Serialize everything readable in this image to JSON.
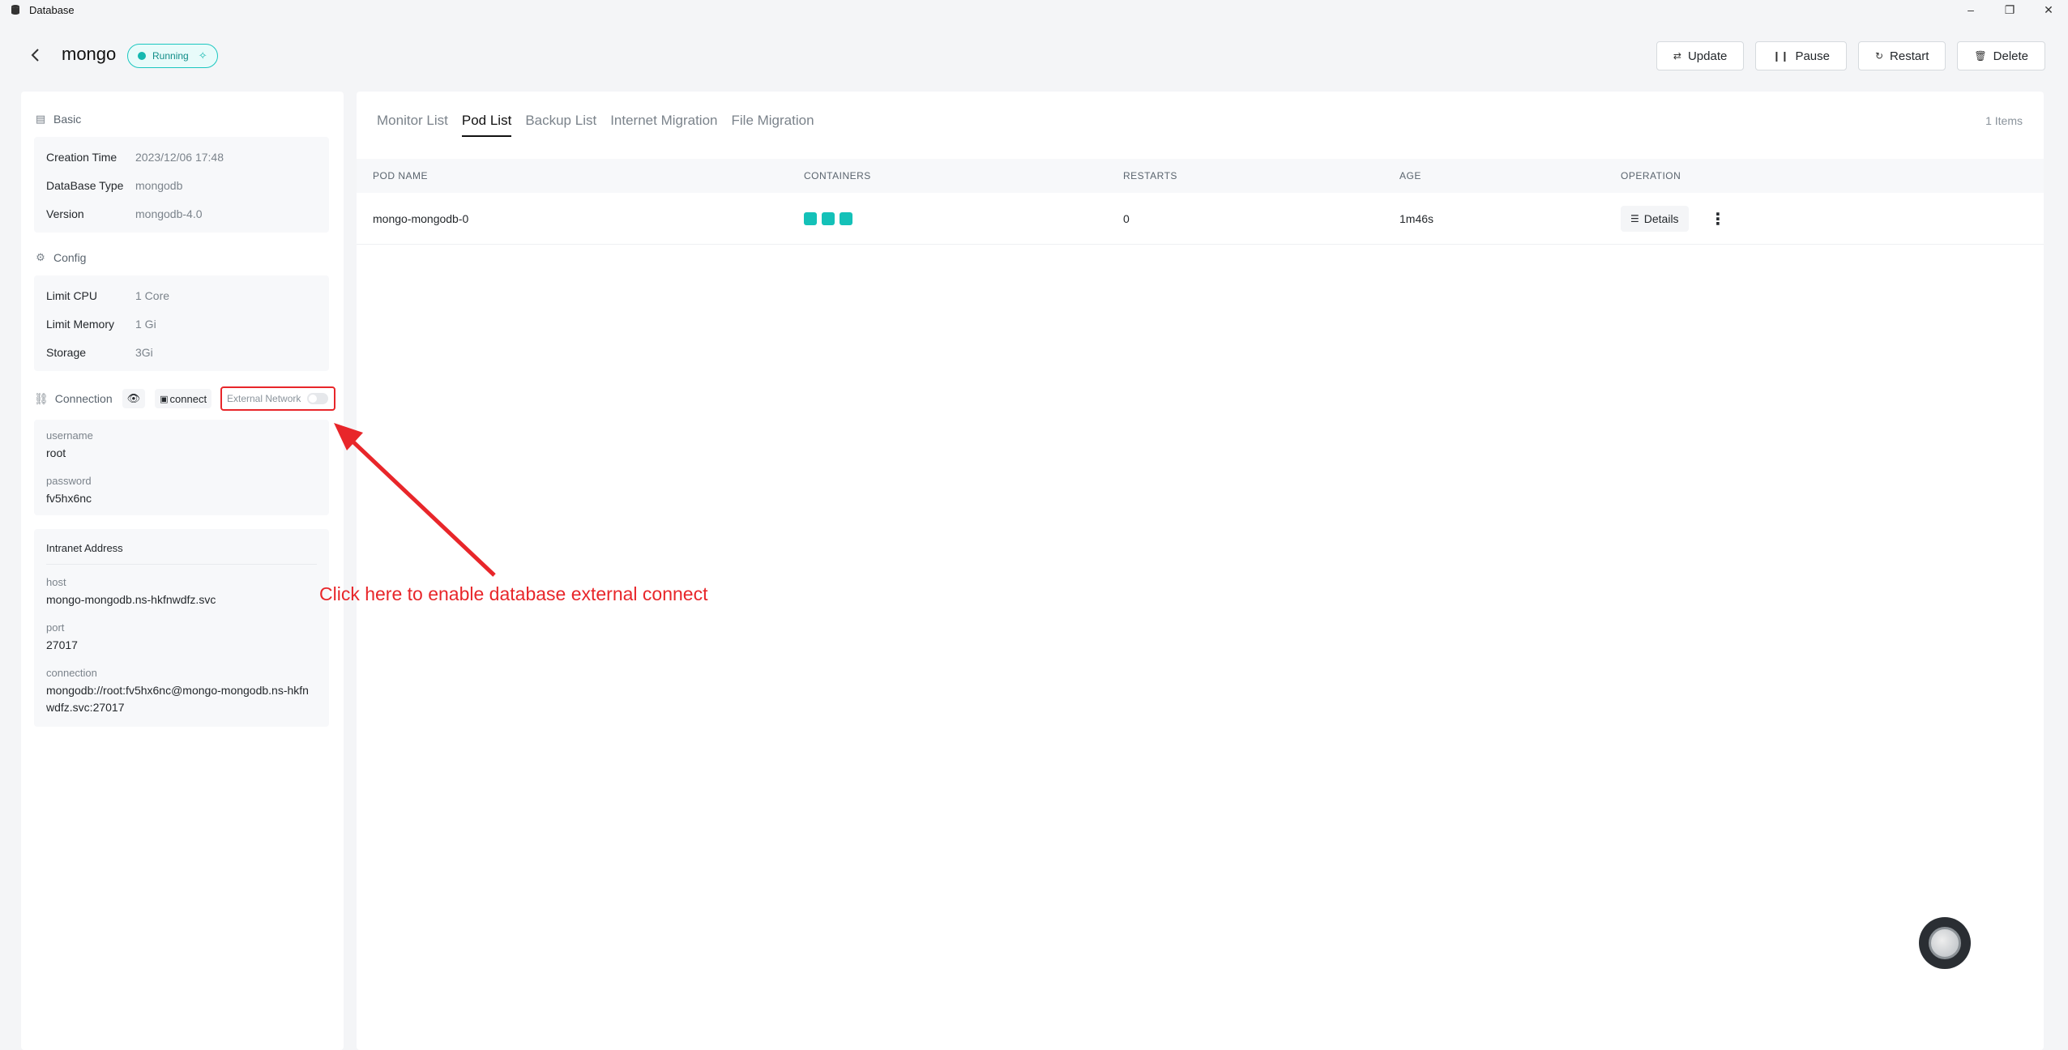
{
  "window": {
    "title": "Database"
  },
  "header": {
    "name": "mongo",
    "status": "Running",
    "actions": {
      "update": "Update",
      "pause": "Pause",
      "restart": "Restart",
      "delete": "Delete"
    }
  },
  "basic": {
    "title": "Basic",
    "rows": [
      {
        "k": "Creation Time",
        "v": "2023/12/06 17:48"
      },
      {
        "k": "DataBase Type",
        "v": "mongodb"
      },
      {
        "k": "Version",
        "v": "mongodb-4.0"
      }
    ]
  },
  "config": {
    "title": "Config",
    "rows": [
      {
        "k": "Limit CPU",
        "v": "1 Core"
      },
      {
        "k": "Limit Memory",
        "v": "1 Gi"
      },
      {
        "k": "Storage",
        "v": "3Gi"
      }
    ]
  },
  "connection": {
    "title": "Connection",
    "connect_label": "connect",
    "external_network_label": "External Network",
    "external_network_enabled": false,
    "username_label": "username",
    "username": "root",
    "password_label": "password",
    "password": "fv5hx6nc"
  },
  "intranet": {
    "title": "Intranet Address",
    "host_label": "host",
    "host": "mongo-mongodb.ns-hkfnwdfz.svc",
    "port_label": "port",
    "port": "27017",
    "connection_label": "connection",
    "connection": "mongodb://root:fv5hx6nc@mongo-mongodb.ns-hkfnwdfz.svc:27017"
  },
  "tabs": [
    "Monitor List",
    "Pod List",
    "Backup List",
    "Internet Migration",
    "File Migration"
  ],
  "active_tab": "Pod List",
  "items_count": "1 Items",
  "table": {
    "headers": [
      "POD NAME",
      "CONTAINERS",
      "RESTARTS",
      "AGE",
      "OPERATION"
    ],
    "rows": [
      {
        "pod_name": "mongo-mongodb-0",
        "containers": 3,
        "restarts": "0",
        "age": "1m46s",
        "details": "Details"
      }
    ]
  },
  "annotation": {
    "text": "Click here to enable database external connect",
    "color": "#e8262a"
  },
  "colors": {
    "accent": "#14c1b8",
    "annotation": "#e8262a"
  }
}
